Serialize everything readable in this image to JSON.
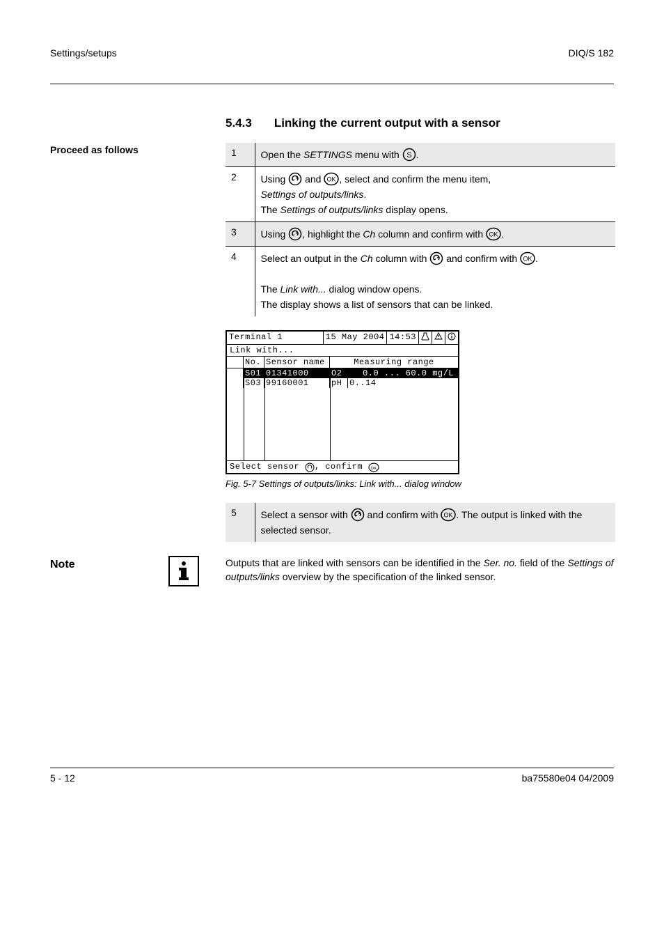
{
  "header": {
    "left": "Settings/setups",
    "right": "DIQ/S 182"
  },
  "section": {
    "number": "5.4.3",
    "title": "Linking the current output with a sensor"
  },
  "steps_heading": "Proceed as follows",
  "keys": {
    "s": "S",
    "ok": "OK"
  },
  "steps": [
    {
      "n": "1",
      "lines": [
        "Open the SETTINGS menu with S."
      ],
      "shaded": true
    },
    {
      "n": "2",
      "lines": [
        "Using TOGGLE and OK, select and confirm the menu item,",
        "Settings of outputs/links.",
        "The Settings of outputs/links display opens."
      ]
    },
    {
      "n": "3",
      "lines": [
        "Using TOGGLE, highlight the Ch column and confirm with OK."
      ],
      "shaded": true
    },
    {
      "n": "4",
      "lines": [
        "Select an output in the Ch column with TOGGLE and confirm with OK.",
        "",
        "The Link with... dialog window opens.",
        "The display shows a list of sensors that can be linked."
      ]
    }
  ],
  "screenshot": {
    "header": {
      "title": "Terminal 1",
      "date": "15 May  2004",
      "time": "14:53"
    },
    "subtitle": "Link with...",
    "columns": {
      "no": "No.",
      "name": "Sensor name",
      "range": "Measuring range"
    },
    "rows": [
      {
        "no": "S01",
        "name": "01341000",
        "param": "O2",
        "range": "0.0 ... 60.0 mg/L",
        "selected": true
      },
      {
        "no": "S03",
        "name": "99160001",
        "param": "pH",
        "range": "0..14",
        "selected": false
      }
    ],
    "footer_a": "Select sensor ",
    "footer_b": ", confirm "
  },
  "figure_caption": "Fig. 5-7   Settings of outputs/links: Link with... dialog window",
  "step5": {
    "n": "5",
    "text": "Select a sensor with TOGGLE and confirm with OK. The output is linked with the selected sensor.",
    "shaded": true
  },
  "note": {
    "label": "Note",
    "text": "Outputs that are linked with sensors can be identified in the Ser. no. field of the Settings of outputs/links overview by the specification of the linked sensor."
  },
  "footer": {
    "left": "5 - 12",
    "right": "ba75580e04     04/2009"
  }
}
